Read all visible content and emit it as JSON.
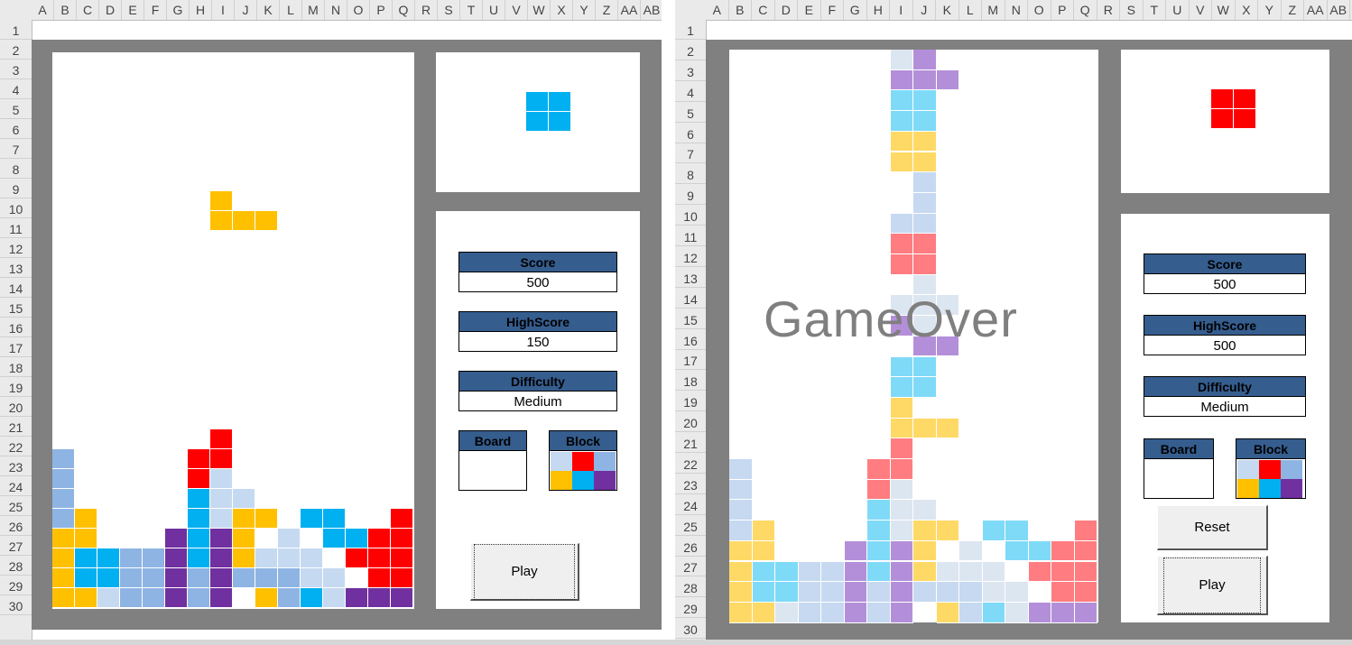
{
  "colors": {
    "yellow": "#ffc000",
    "cyan": "#00b0f0",
    "steel": "#8eb4e3",
    "pale": "#c5d9f1",
    "purple": "#7030a0",
    "red": "#ff0000",
    "header_blue": "#355d8e",
    "frame_gray": "#808080"
  },
  "left": {
    "columns": [
      "A",
      "B",
      "C",
      "D",
      "E",
      "F",
      "G",
      "H",
      "I",
      "J",
      "K",
      "L",
      "M",
      "N",
      "O",
      "P",
      "Q",
      "R",
      "S",
      "T",
      "U",
      "V",
      "W",
      "X",
      "Y",
      "Z",
      "AA",
      "AB"
    ],
    "rows": [
      "1",
      "2",
      "3",
      "4",
      "5",
      "6",
      "7",
      "8",
      "9",
      "10",
      "11",
      "12",
      "13",
      "14",
      "15",
      "16",
      "17",
      "18",
      "19",
      "20",
      "21",
      "22",
      "23",
      "24",
      "25",
      "26",
      "27",
      "28",
      "29",
      "30"
    ],
    "score_label": "Score",
    "score_value": "500",
    "highscore_label": "HighScore",
    "highscore_value": "150",
    "difficulty_label": "Difficulty",
    "difficulty_value": "Medium",
    "board_label": "Board",
    "block_label": "Block",
    "play_label": "Play",
    "next_piece_color": "cyan",
    "falling_piece_color": "yellow"
  },
  "right": {
    "columns": [
      "A",
      "B",
      "C",
      "D",
      "E",
      "F",
      "G",
      "H",
      "I",
      "J",
      "K",
      "L",
      "M",
      "N",
      "O",
      "P",
      "Q",
      "R",
      "S",
      "T",
      "U",
      "V",
      "W",
      "X",
      "Y",
      "Z",
      "AA",
      "AB"
    ],
    "rows": [
      "1",
      "2",
      "3",
      "4",
      "5",
      "6",
      "7",
      "8",
      "9",
      "10",
      "11",
      "12",
      "13",
      "14",
      "15",
      "16",
      "17",
      "18",
      "19",
      "20",
      "21",
      "22",
      "23",
      "24",
      "25",
      "26",
      "27",
      "28",
      "29",
      "30"
    ],
    "game_over_text": "GameOver",
    "score_label": "Score",
    "score_value": "500",
    "highscore_label": "HighScore",
    "highscore_value": "500",
    "difficulty_label": "Difficulty",
    "difficulty_value": "Medium",
    "board_label": "Board",
    "block_label": "Block",
    "reset_label": "Reset",
    "play_label": "Play",
    "next_piece_color": "red"
  },
  "block_palette": [
    "pale",
    "red",
    "steel",
    "yellow",
    "cyan",
    "purple"
  ]
}
